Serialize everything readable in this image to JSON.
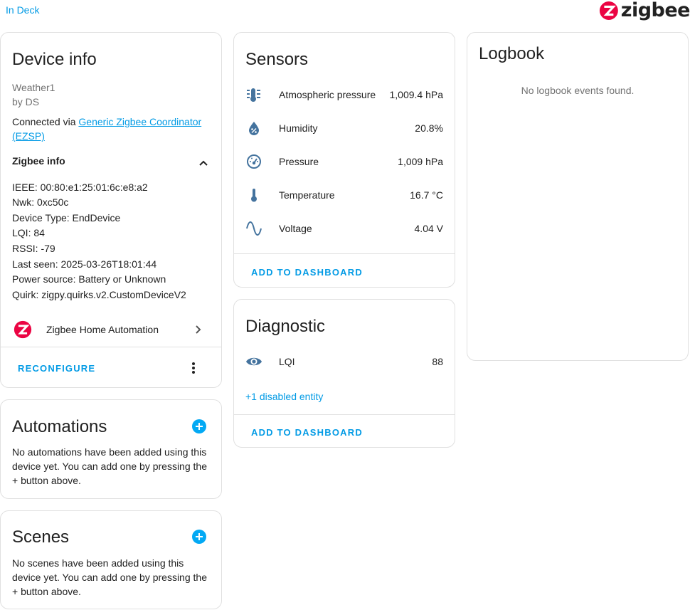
{
  "header": {
    "area_link": "In Deck",
    "logo_text": "zigbee"
  },
  "device_info": {
    "title": "Device info",
    "device_name": "Weather1",
    "manufacturer": "by DS",
    "connected_prefix": "Connected via ",
    "connected_link": "Generic Zigbee Coordinator (EZSP)",
    "zigbee_info_title": "Zigbee info",
    "zigbee_lines": [
      "IEEE: 00:80:e1:25:01:6c:e8:a2",
      "Nwk: 0xc50c",
      "Device Type: EndDevice",
      "LQI: 84",
      "RSSI: -79",
      "Last seen: 2025-03-26T18:01:44",
      "Power source: Battery or Unknown",
      "Quirk: zigpy.quirks.v2.CustomDeviceV2"
    ],
    "integration_label": "Zigbee Home Automation",
    "reconfigure_label": "RECONFIGURE"
  },
  "automations": {
    "title": "Automations",
    "empty_text": "No automations have been added using this device yet. You can add one by pressing the + button above."
  },
  "scenes": {
    "title": "Scenes",
    "empty_text": "No scenes have been added using this device yet. You can add one by pressing the + button above."
  },
  "sensors": {
    "title": "Sensors",
    "rows": [
      {
        "icon": "gauge-bars-icon",
        "name": "Atmospheric pressure",
        "value": "1,009.4 hPa"
      },
      {
        "icon": "water-percent-icon",
        "name": "Humidity",
        "value": "20.8%"
      },
      {
        "icon": "gauge-icon",
        "name": "Pressure",
        "value": "1,009 hPa"
      },
      {
        "icon": "thermometer-icon",
        "name": "Temperature",
        "value": "16.7 °C"
      },
      {
        "icon": "sine-wave-icon",
        "name": "Voltage",
        "value": "4.04 V"
      }
    ],
    "add_label": "ADD TO DASHBOARD"
  },
  "diagnostic": {
    "title": "Diagnostic",
    "rows": [
      {
        "icon": "eye-icon",
        "name": "LQI",
        "value": "88"
      }
    ],
    "disabled_link": "+1 disabled entity",
    "add_label": "ADD TO DASHBOARD"
  },
  "logbook": {
    "title": "Logbook",
    "empty_text": "No logbook events found."
  },
  "colors": {
    "accent": "#039be5",
    "icon": "#44739e",
    "zigbee_red": "#eb0443"
  }
}
